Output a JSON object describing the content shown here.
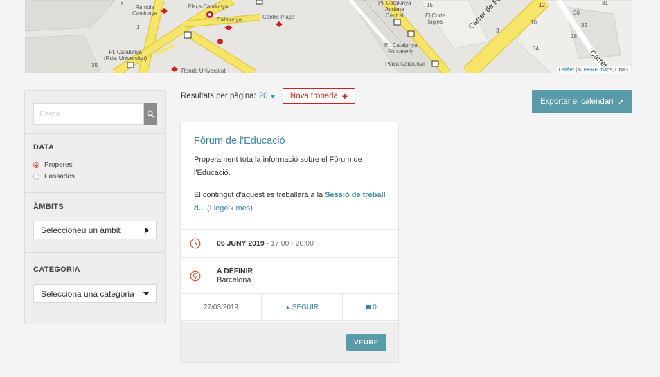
{
  "map": {
    "labels": {
      "rambla": "Rambla\nCatalunya",
      "placa_cat": "Plaça Catalunya",
      "catalunya": "Catalunya",
      "centre_placa": "Centre Plaça",
      "pl_cat_univ": "Pl. Catalunya\n(Rda. Universitat)",
      "ronda_univ": "Ronda Universitat",
      "pl_cat_andana": "Pl. Catalunya\nAndana\nCentral",
      "el_corte": "El Corte\nIngles",
      "pl_cat_font": "Pl. Catalunya\nFontanella",
      "placa_cat2": "Plaça Catalunya",
      "carrer_font": "Carrer de Fontanella",
      "carrer": "Carrer",
      "n5": "5",
      "n1": "1",
      "n35": "35",
      "n15": "15",
      "n3": "3",
      "n10": "10",
      "n12": "12",
      "n36": "36",
      "n32": "32",
      "n28": "28",
      "n34": "34",
      "n31": "31"
    },
    "attribution": {
      "leaflet": "Leaflet",
      "sep": " | © ",
      "here": "HERE maps",
      "cnig": ", CNIG."
    },
    "colors": {
      "road": "#f7e56a",
      "road_border": "#e2cc3a",
      "ground": "#e8e6e2",
      "metro": "#cc1f1f"
    }
  },
  "sidebar": {
    "search": {
      "placeholder": "Cerca"
    },
    "data": {
      "title": "DATA",
      "options": [
        {
          "label": "Properes",
          "selected": true
        },
        {
          "label": "Passades",
          "selected": false
        }
      ]
    },
    "ambits": {
      "title": "ÀMBITS",
      "select_label": "Seleccioneu un àmbit"
    },
    "categoria": {
      "title": "CATEGORIA",
      "select_label": "Selecciona una categoria"
    }
  },
  "toolbar": {
    "per_page_label": "Resultats per pàgina:",
    "per_page_value": "20",
    "new_label": "Nova trobada",
    "new_icon": "+",
    "export_label": "Exportar el calendari",
    "export_icon": "↗"
  },
  "card": {
    "title": "Fòrum de l'Educació",
    "desc1": "Properament tota la informació sobre el Fòrum de l'Educació.",
    "desc2_prefix": "El contingut d'aquest es treballarà a la ",
    "desc2_link": "Sessió de treball d...",
    "desc2_more": " (Llegeix més)",
    "date": "06 JUNY 2019",
    "date_sep": " · ",
    "time": "17:00 - 20:00",
    "place_title": "A DEFINIR",
    "place_city": "Barcelona",
    "published": "27/03/2019",
    "follow_icon": "▲",
    "follow_label": "SEGUIR",
    "comments_count": "0",
    "view_label": "VEURE"
  },
  "colors": {
    "accent": "#3d86a6",
    "button": "#5a9ba9",
    "red": "#cc1f1f",
    "radio": "#d5522e"
  }
}
